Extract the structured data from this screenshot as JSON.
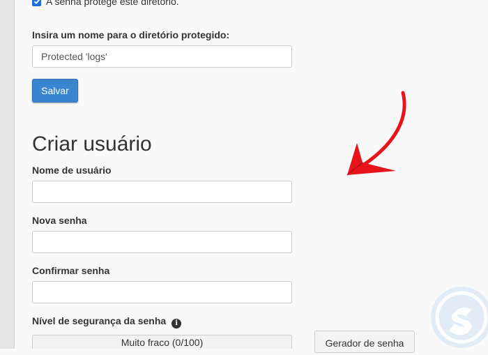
{
  "protection": {
    "checkbox_label": "A senha protege este diretório.",
    "checked": true
  },
  "directory_name": {
    "label": "Insira um nome para o diretório protegido:",
    "value": "Protected 'logs'"
  },
  "save_button": "Salvar",
  "create_user": {
    "title": "Criar usuário",
    "username_label": "Nome de usuário",
    "new_password_label": "Nova senha",
    "confirm_password_label": "Confirmar senha",
    "strength_label": "Nível de segurança da senha",
    "strength_value": "Muito fraco (0/100)",
    "generator_button": "Gerador de senha"
  },
  "colors": {
    "primary": "#3a85d0",
    "arrow": "#e8141c"
  },
  "icons": [
    "check-icon",
    "info-icon",
    "red-arrow",
    "logo-icon"
  ]
}
